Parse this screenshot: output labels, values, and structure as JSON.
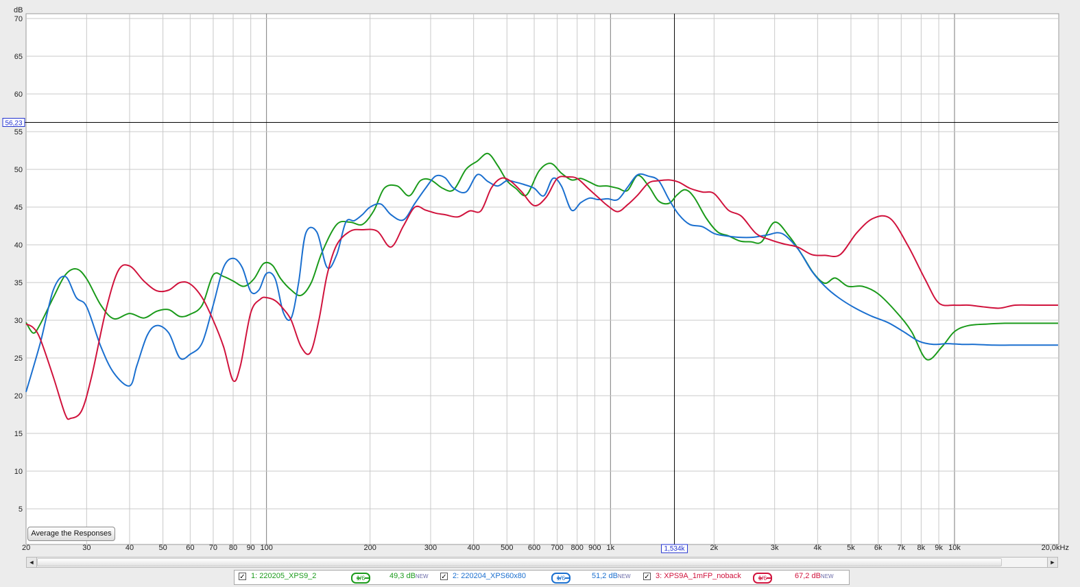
{
  "chart_data": {
    "type": "line",
    "ylabel": "dB",
    "y_axis_scale": "linear",
    "x_axis_scale": "log",
    "xlim": [
      20,
      20000
    ],
    "ylim": [
      0,
      70
    ],
    "grid": true,
    "y_ticks": [
      5,
      10,
      15,
      20,
      25,
      30,
      35,
      40,
      45,
      50,
      55,
      60,
      65,
      70
    ],
    "y_tick_labels": [
      "5",
      "10",
      "15",
      "20",
      "25",
      "30",
      "35",
      "40",
      "45",
      "50",
      "55",
      "60",
      "65",
      "70"
    ],
    "x_ticks": [
      20,
      30,
      40,
      50,
      60,
      70,
      80,
      90,
      100,
      200,
      300,
      400,
      500,
      600,
      700,
      800,
      900,
      1000,
      2000,
      3000,
      4000,
      5000,
      6000,
      7000,
      8000,
      9000,
      10000,
      20000
    ],
    "x_tick_labels": [
      "20",
      "30",
      "40",
      "50",
      "60",
      "70",
      "80",
      "90",
      "100",
      "200",
      "300",
      "400",
      "500",
      "600",
      "700",
      "800",
      "900",
      "1k",
      "2k",
      "3k",
      "4k",
      "5k",
      "6k",
      "7k",
      "8k",
      "9k",
      "10k",
      "20,0kHz"
    ],
    "cursor": {
      "x": 1534,
      "y": 56.23,
      "x_label": "1,534k",
      "y_label": "56,23"
    },
    "series": [
      {
        "name": "1: 220205_XPS9_2",
        "color": "#1a9a1a",
        "smoothing": "1/6",
        "level": "49,3 dB",
        "x": [
          20,
          21,
          22,
          24,
          26,
          28,
          30,
          33,
          36,
          40,
          44,
          48,
          52,
          56,
          60,
          65,
          70,
          75,
          80,
          86,
          92,
          98,
          104,
          110,
          118,
          126,
          135,
          145,
          160,
          175,
          190,
          205,
          220,
          240,
          260,
          280,
          300,
          325,
          350,
          380,
          410,
          440,
          470,
          500,
          530,
          570,
          620,
          670,
          720,
          770,
          820,
          870,
          920,
          980,
          1050,
          1120,
          1200,
          1290,
          1380,
          1480,
          1560,
          1650,
          1750,
          1900,
          2050,
          2200,
          2380,
          2560,
          2750,
          3000,
          3300,
          3600,
          3900,
          4200,
          4500,
          4900,
          5400,
          6000,
          6800,
          7500,
          8300,
          9200,
          10000,
          11000,
          12500,
          14000,
          15500,
          17000,
          18500,
          20000
        ],
        "y": [
          29.7,
          28.3,
          29.5,
          33,
          36,
          36.8,
          35.5,
          32,
          30.2,
          30.9,
          30.3,
          31.2,
          31.4,
          30.5,
          30.8,
          32,
          36,
          35.8,
          35.2,
          34.5,
          35.5,
          37.5,
          37.3,
          35.5,
          34,
          33.3,
          35,
          39,
          42.7,
          43,
          42.7,
          44.5,
          47.5,
          47.8,
          46.5,
          48.5,
          48.6,
          47.5,
          47.3,
          50,
          51.1,
          52.1,
          50.5,
          48.5,
          47.5,
          46.6,
          49.8,
          50.8,
          49.5,
          48.6,
          48.8,
          48.3,
          47.8,
          47.8,
          47.5,
          47.2,
          49.2,
          47.8,
          45.8,
          45.5,
          46.6,
          47.3,
          46.3,
          43.5,
          41.7,
          41.2,
          40.5,
          40.4,
          40.4,
          43,
          41.2,
          38.7,
          36.2,
          34.9,
          35.6,
          34.5,
          34.5,
          33.5,
          31,
          28.5,
          24.8,
          26.5,
          28.5,
          29.3,
          29.5,
          29.6,
          29.6,
          29.6,
          29.6,
          29.6
        ],
        "x_dense": true
      },
      {
        "name": "2: 220204_XPS60x80",
        "color": "#1a6fcf",
        "smoothing": "1/6",
        "level": "51,2 dB",
        "x": [
          20,
          22,
          24,
          26,
          28,
          30,
          33,
          36,
          40,
          42,
          45,
          48,
          52,
          56,
          60,
          65,
          70,
          75,
          80,
          85,
          90,
          95,
          100,
          106,
          112,
          118,
          124,
          130,
          140,
          150,
          160,
          170,
          180,
          190,
          200,
          215,
          230,
          250,
          270,
          290,
          310,
          330,
          350,
          380,
          410,
          440,
          470,
          500,
          530,
          560,
          600,
          640,
          680,
          720,
          770,
          820,
          870,
          920,
          980,
          1050,
          1120,
          1200,
          1290,
          1380,
          1480,
          1580,
          1700,
          1850,
          2000,
          2150,
          2350,
          2600,
          2850,
          3150,
          3500,
          3850,
          4200,
          4600,
          5100,
          5700,
          6400,
          7100,
          7900,
          8700,
          9500,
          10500,
          11500,
          13000,
          14500,
          16000,
          18000,
          20000
        ],
        "y": [
          20.5,
          27,
          34,
          35.8,
          33,
          31.8,
          26.5,
          23,
          21.3,
          24,
          28,
          29.3,
          28.3,
          25,
          25.5,
          27,
          32,
          37,
          38.2,
          37,
          33.8,
          34,
          36.2,
          35.5,
          31,
          30.3,
          35,
          41.5,
          41.7,
          37,
          38.7,
          43,
          43.2,
          44,
          45,
          45.4,
          44,
          43.3,
          45.5,
          47.5,
          49.1,
          48.9,
          47.5,
          47,
          49.3,
          48.4,
          47.8,
          48.5,
          48.3,
          48,
          47.5,
          46.5,
          48.8,
          47.8,
          44.6,
          45.6,
          46.2,
          46,
          46.1,
          46,
          47.6,
          49.3,
          49.1,
          48.5,
          46,
          44,
          42.7,
          42.4,
          41.5,
          41.2,
          41,
          41,
          41.3,
          41.5,
          39.5,
          36.5,
          34.5,
          33,
          31.7,
          30.6,
          29.7,
          28.5,
          27.2,
          26.8,
          26.9,
          26.8,
          26.8,
          26.7,
          26.7,
          26.7,
          26.7,
          26.7
        ],
        "x_dense": true
      },
      {
        "name": "3: XPS9A_1mFP_noback",
        "color": "#d0123c",
        "smoothing": "1/6",
        "level": "67,2 dB",
        "x": [
          20,
          21,
          22,
          24,
          26,
          27,
          29,
          31,
          34,
          37,
          40,
          44,
          48,
          52,
          56,
          60,
          65,
          70,
          75,
          80,
          84,
          90,
          96,
          100,
          106,
          112,
          118,
          126,
          134,
          142,
          150,
          160,
          175,
          190,
          210,
          230,
          250,
          270,
          290,
          310,
          330,
          360,
          390,
          420,
          450,
          480,
          510,
          550,
          600,
          650,
          700,
          750,
          800,
          860,
          920,
          980,
          1050,
          1120,
          1200,
          1290,
          1380,
          1480,
          1580,
          1700,
          1850,
          2000,
          2200,
          2400,
          2650,
          2900,
          3200,
          3500,
          3850,
          4200,
          4650,
          5200,
          5800,
          6500,
          7300,
          8200,
          9000,
          10000,
          11000,
          12000,
          13500,
          15000,
          17000,
          18500,
          20000
        ],
        "y": [
          29.5,
          29,
          27.5,
          22.5,
          17.5,
          17,
          18,
          22.5,
          31,
          36.5,
          37.2,
          35.2,
          33.9,
          34,
          35,
          34.8,
          33,
          30,
          26.5,
          22,
          24,
          31,
          32.8,
          33,
          32.6,
          31.5,
          30,
          26.5,
          25.7,
          30,
          36,
          40,
          41.8,
          42,
          41.8,
          39.7,
          42.5,
          45,
          44.6,
          44.2,
          44,
          43.7,
          44.5,
          44.5,
          47.5,
          48.8,
          48.5,
          47.1,
          45.2,
          46.3,
          48.8,
          49,
          48.8,
          47.5,
          46.3,
          45.2,
          44.4,
          45.3,
          46.6,
          48.2,
          48.5,
          48.6,
          48.3,
          47.5,
          47,
          46.8,
          44.6,
          43.8,
          41.5,
          40.7,
          40.1,
          39.7,
          38.7,
          38.6,
          38.7,
          41.6,
          43.5,
          43.5,
          40,
          35.5,
          32.3,
          32,
          32,
          31.8,
          31.6,
          32,
          32,
          32,
          32
        ],
        "x_dense": true
      }
    ]
  },
  "controls": {
    "average_button": "Average the Responses",
    "scroll_left": "◄",
    "scroll_right": "►"
  },
  "legend": {
    "items": [
      {
        "check": "✓",
        "name": "1: 220205_XPS9_2",
        "smoothing": "1/6",
        "level": "49,3 dB",
        "new": "NEW",
        "color": "#1a9a1a"
      },
      {
        "check": "✓",
        "name": "2: 220204_XPS60x80",
        "smoothing": "1/6",
        "level": "51,2 dB",
        "new": "NEW",
        "color": "#1a6fcf"
      },
      {
        "check": "✓",
        "name": "3: XPS9A_1mFP_noback",
        "smoothing": "1/6",
        "level": "67,2 dB",
        "new": "NEW",
        "color": "#d0123c"
      }
    ]
  }
}
